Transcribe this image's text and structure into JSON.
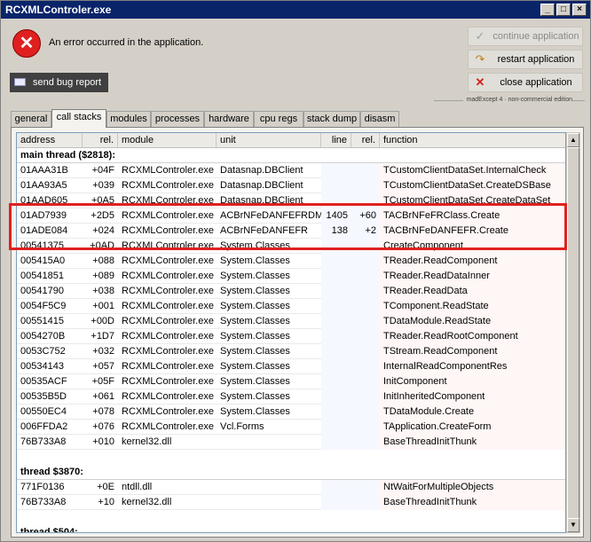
{
  "window": {
    "title": "RCXMLControler.exe"
  },
  "error": {
    "message": "An error occurred in the application."
  },
  "buttons": {
    "bug_report": "send bug report",
    "continue": "continue application",
    "restart": "restart application",
    "close": "close application"
  },
  "edition": "madExcept 4 · non-commercial edition",
  "tabs": [
    "general",
    "call stacks",
    "modules",
    "processes",
    "hardware",
    "cpu regs",
    "stack dump",
    "disasm"
  ],
  "columns": [
    "address",
    "rel.",
    "module",
    "unit",
    "line",
    "rel.",
    "function"
  ],
  "rows": [
    {
      "thread": "main thread ($2818):"
    },
    {
      "address": "01AAA31B",
      "rel": "+04F",
      "module": "RCXMLControler.exe",
      "unit": "Datasnap.DBClient",
      "line": "",
      "rel2": "",
      "function": "TCustomClientDataSet.InternalCheck"
    },
    {
      "address": "01AA93A5",
      "rel": "+039",
      "module": "RCXMLControler.exe",
      "unit": "Datasnap.DBClient",
      "line": "",
      "rel2": "",
      "function": "TCustomClientDataSet.CreateDSBase"
    },
    {
      "address": "01AAD605",
      "rel": "+0A5",
      "module": "RCXMLControler.exe",
      "unit": "Datasnap.DBClient",
      "line": "",
      "rel2": "",
      "function": "TCustomClientDataSet.CreateDataSet"
    },
    {
      "address": "01AD7939",
      "rel": "+2D5",
      "module": "RCXMLControler.exe",
      "unit": "ACBrNFeDANFEFRDM",
      "line": "1405",
      "rel2": "+60",
      "function": "TACBrNFeFRClass.Create"
    },
    {
      "address": "01ADE084",
      "rel": "+024",
      "module": "RCXMLControler.exe",
      "unit": "ACBrNFeDANFEFR",
      "line": "138",
      "rel2": "+2",
      "function": "TACBrNFeDANFEFR.Create"
    },
    {
      "address": "00541375",
      "rel": "+0AD",
      "module": "RCXMLControler.exe",
      "unit": "System.Classes",
      "line": "",
      "rel2": "",
      "function": "CreateComponent"
    },
    {
      "address": "005415A0",
      "rel": "+088",
      "module": "RCXMLControler.exe",
      "unit": "System.Classes",
      "line": "",
      "rel2": "",
      "function": "TReader.ReadComponent"
    },
    {
      "address": "00541851",
      "rel": "+089",
      "module": "RCXMLControler.exe",
      "unit": "System.Classes",
      "line": "",
      "rel2": "",
      "function": "TReader.ReadDataInner"
    },
    {
      "address": "00541790",
      "rel": "+038",
      "module": "RCXMLControler.exe",
      "unit": "System.Classes",
      "line": "",
      "rel2": "",
      "function": "TReader.ReadData"
    },
    {
      "address": "0054F5C9",
      "rel": "+001",
      "module": "RCXMLControler.exe",
      "unit": "System.Classes",
      "line": "",
      "rel2": "",
      "function": "TComponent.ReadState"
    },
    {
      "address": "00551415",
      "rel": "+00D",
      "module": "RCXMLControler.exe",
      "unit": "System.Classes",
      "line": "",
      "rel2": "",
      "function": "TDataModule.ReadState"
    },
    {
      "address": "0054270B",
      "rel": "+1D7",
      "module": "RCXMLControler.exe",
      "unit": "System.Classes",
      "line": "",
      "rel2": "",
      "function": "TReader.ReadRootComponent"
    },
    {
      "address": "0053C752",
      "rel": "+032",
      "module": "RCXMLControler.exe",
      "unit": "System.Classes",
      "line": "",
      "rel2": "",
      "function": "TStream.ReadComponent"
    },
    {
      "address": "00534143",
      "rel": "+057",
      "module": "RCXMLControler.exe",
      "unit": "System.Classes",
      "line": "",
      "rel2": "",
      "function": "InternalReadComponentRes"
    },
    {
      "address": "00535ACF",
      "rel": "+05F",
      "module": "RCXMLControler.exe",
      "unit": "System.Classes",
      "line": "",
      "rel2": "",
      "function": "InitComponent"
    },
    {
      "address": "00535B5D",
      "rel": "+061",
      "module": "RCXMLControler.exe",
      "unit": "System.Classes",
      "line": "",
      "rel2": "",
      "function": "InitInheritedComponent"
    },
    {
      "address": "00550EC4",
      "rel": "+078",
      "module": "RCXMLControler.exe",
      "unit": "System.Classes",
      "line": "",
      "rel2": "",
      "function": "TDataModule.Create"
    },
    {
      "address": "006FFDA2",
      "rel": "+076",
      "module": "RCXMLControler.exe",
      "unit": "Vcl.Forms",
      "line": "",
      "rel2": "",
      "function": "TApplication.CreateForm"
    },
    {
      "address": "76B733A8",
      "rel": "+010",
      "module": "kernel32.dll",
      "unit": "",
      "line": "",
      "rel2": "",
      "function": "BaseThreadInitThunk"
    },
    {
      "blank": true
    },
    {
      "thread": "thread $3870:"
    },
    {
      "address": "771F0136",
      "rel": "+0E",
      "module": "ntdll.dll",
      "unit": "",
      "line": "",
      "rel2": "",
      "function": "NtWaitForMultipleObjects"
    },
    {
      "address": "76B733A8",
      "rel": "+10",
      "module": "kernel32.dll",
      "unit": "",
      "line": "",
      "rel2": "",
      "function": "BaseThreadInitThunk"
    },
    {
      "blank": true
    },
    {
      "thread": "thread $504:"
    }
  ]
}
